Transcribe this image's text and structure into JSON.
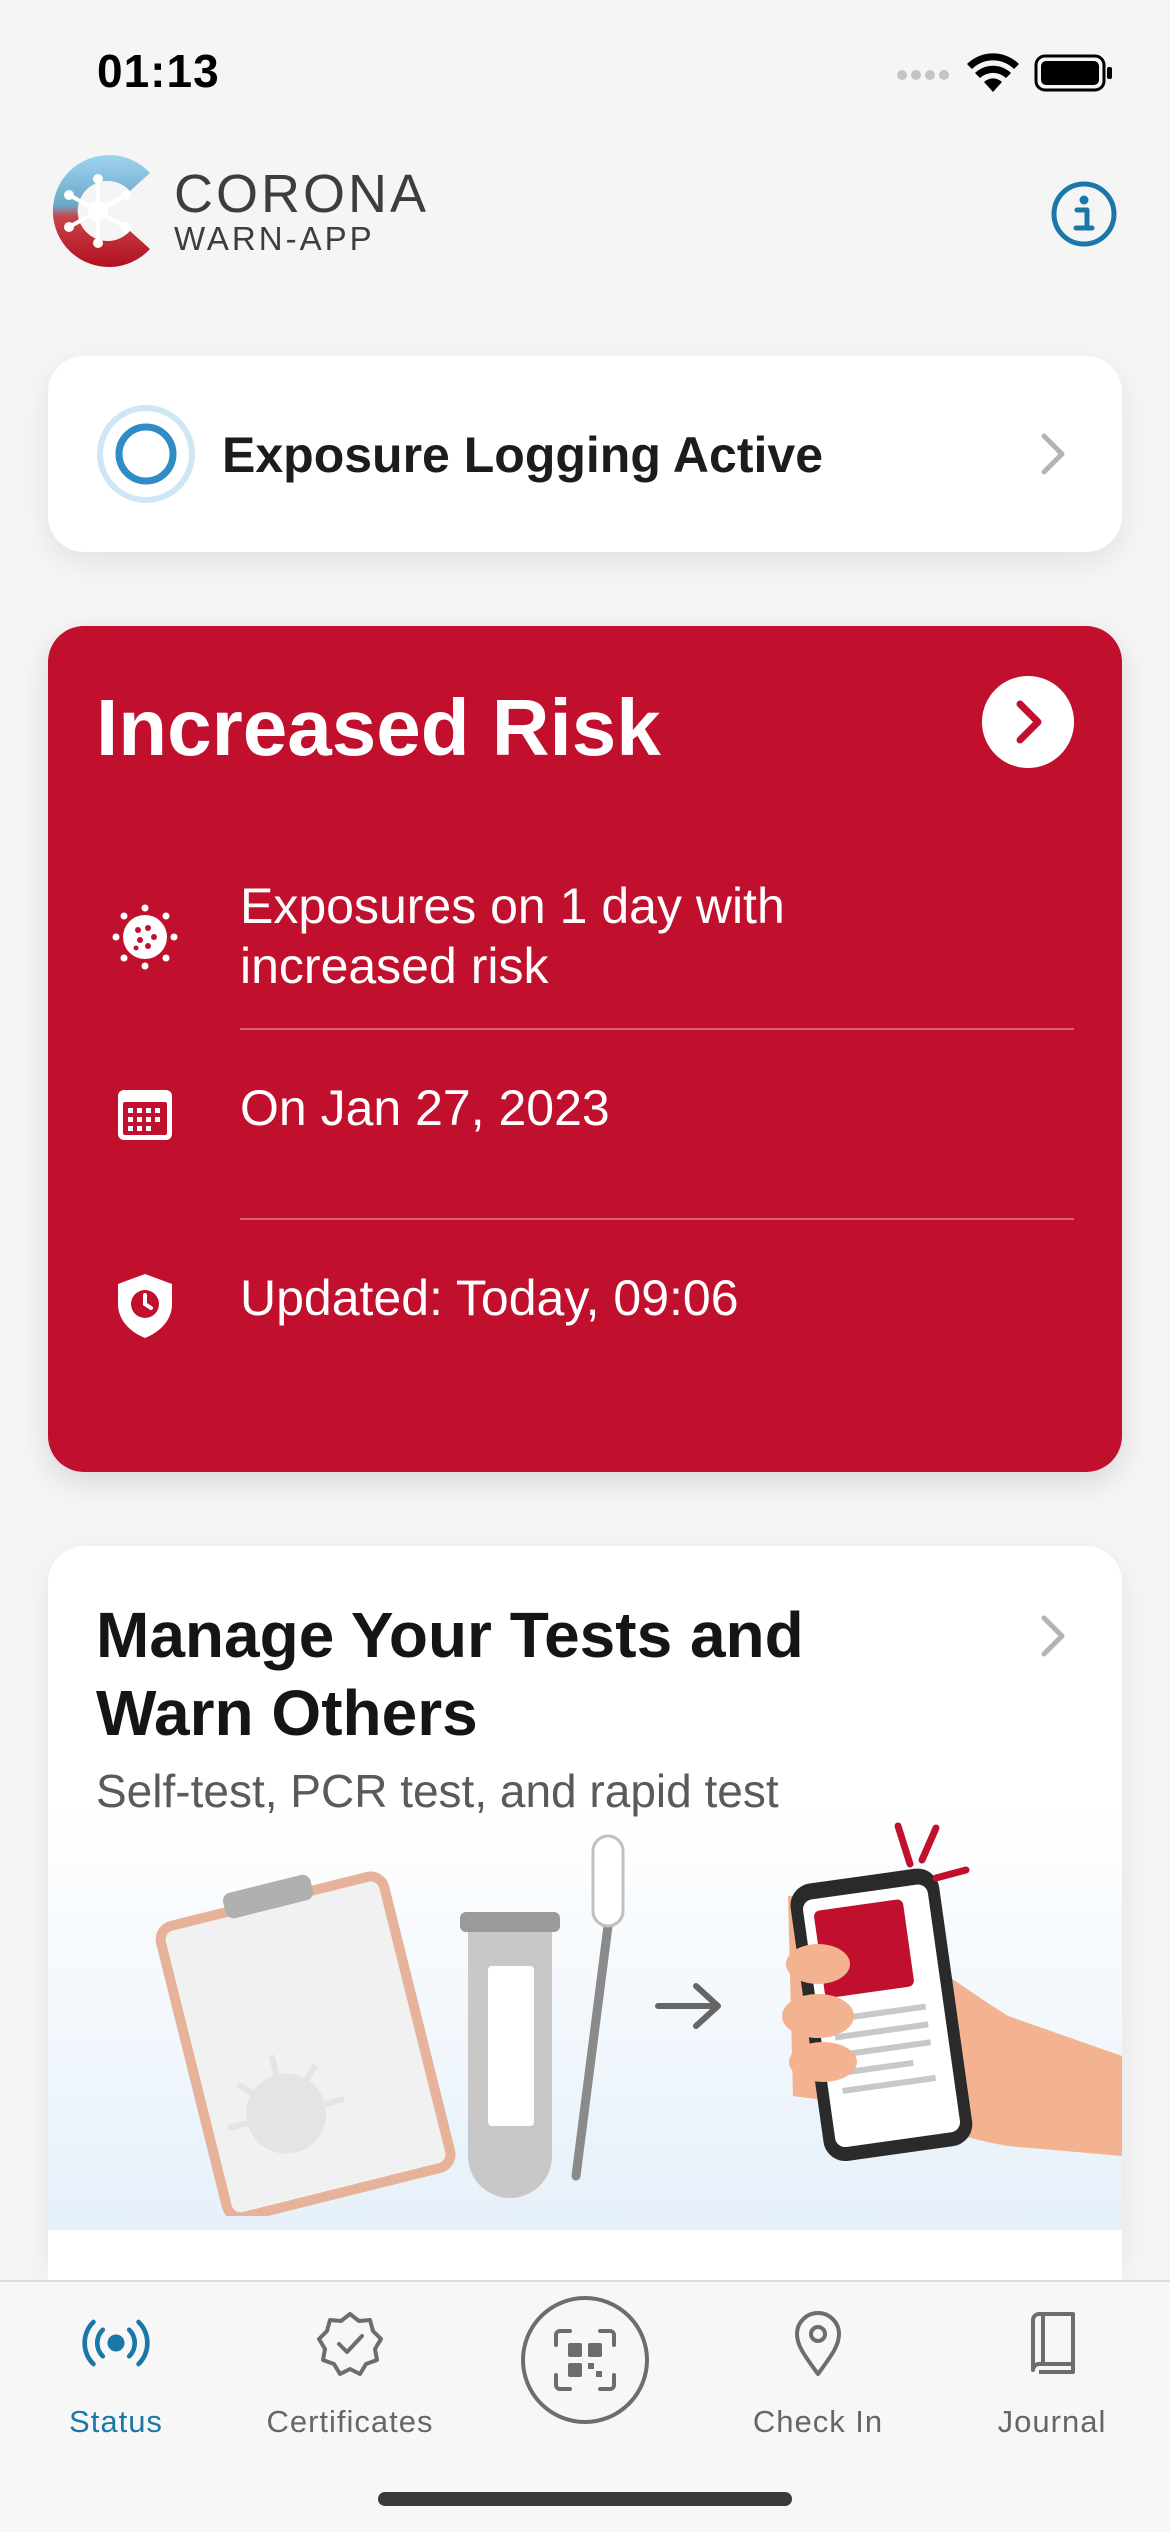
{
  "status_bar": {
    "time": "01:13"
  },
  "header": {
    "logo_title": "CORONA",
    "logo_subtitle": "WARN-APP",
    "info_icon": "info-icon"
  },
  "exposure_logging": {
    "label": "Exposure Logging Active"
  },
  "risk_card": {
    "title": "Increased Risk",
    "color": "#c0102e",
    "rows": [
      {
        "icon": "virus-icon",
        "text": "Exposures on 1 day with increased risk"
      },
      {
        "icon": "calendar-icon",
        "text": "On Jan 27, 2023"
      },
      {
        "icon": "shield-clock-icon",
        "text": "Updated: Today, 09:06"
      }
    ]
  },
  "tests_card": {
    "title": "Manage Your Tests and Warn Others",
    "subtitle": "Self-test, PCR test, and rapid test"
  },
  "tab_bar": {
    "accent_color": "#1a78a8",
    "tabs": [
      {
        "label": "Status",
        "icon": "exposure-waves-icon",
        "active": true
      },
      {
        "label": "Certificates",
        "icon": "certificate-badge-icon",
        "active": false
      },
      {
        "label": "",
        "icon": "qr-scan-icon",
        "active": false
      },
      {
        "label": "Check In",
        "icon": "location-pin-icon",
        "active": false
      },
      {
        "label": "Journal",
        "icon": "book-icon",
        "active": false
      }
    ]
  }
}
